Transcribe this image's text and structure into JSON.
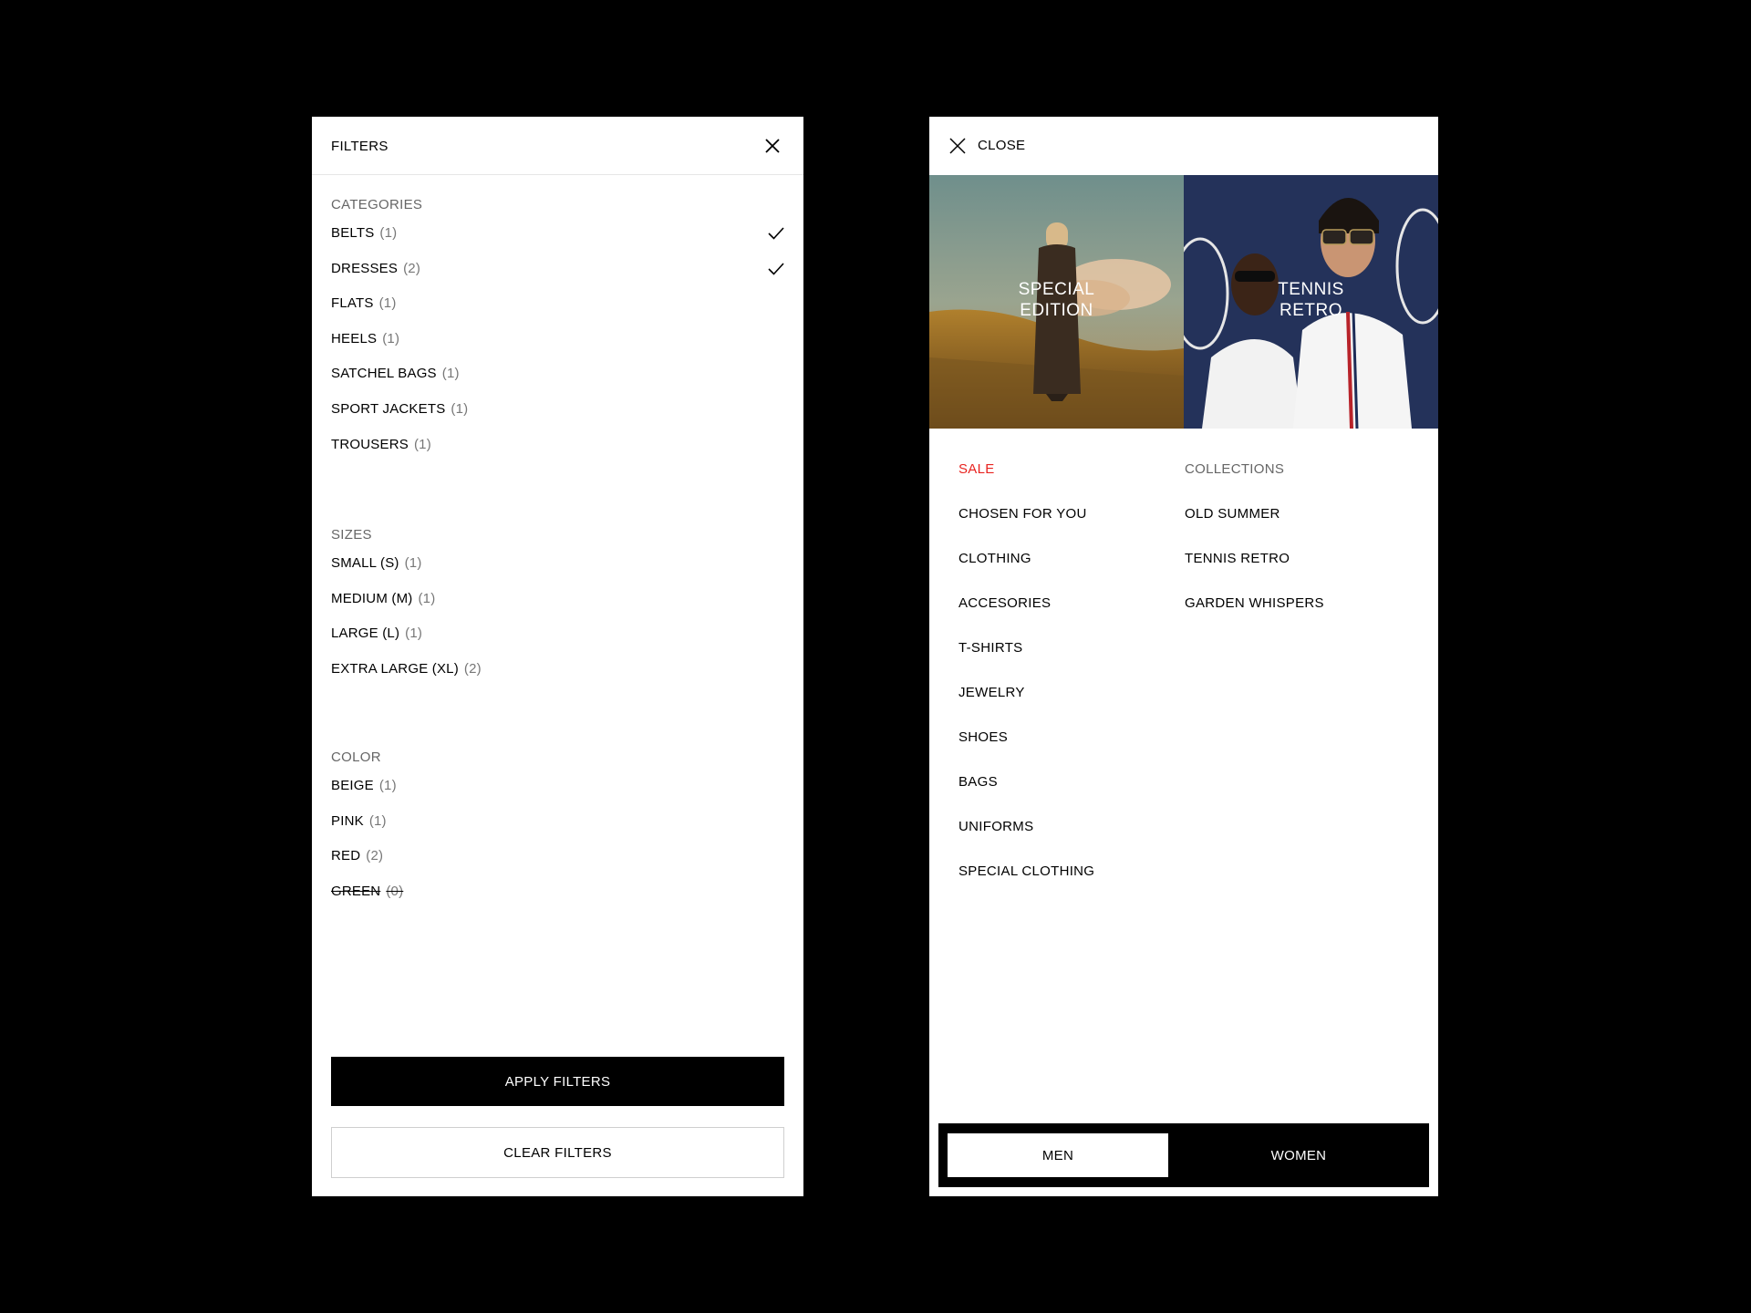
{
  "filters": {
    "title": "FILTERS",
    "sections": [
      {
        "title": "CATEGORIES",
        "options": [
          {
            "label": "BELTS",
            "count": "(1)",
            "checked": true
          },
          {
            "label": "DRESSES",
            "count": "(2)",
            "checked": true
          },
          {
            "label": "FLATS",
            "count": "(1)"
          },
          {
            "label": "HEELS",
            "count": "(1)"
          },
          {
            "label": "SATCHEL BAGS",
            "count": "(1)"
          },
          {
            "label": "SPORT JACKETS",
            "count": "(1)"
          },
          {
            "label": "TROUSERS",
            "count": "(1)"
          }
        ]
      },
      {
        "title": "SIZES",
        "options": [
          {
            "label": "SMALL (S)",
            "count": "(1)"
          },
          {
            "label": "MEDIUM (M)",
            "count": "(1)"
          },
          {
            "label": "LARGE (L)",
            "count": "(1)"
          },
          {
            "label": "EXTRA LARGE (XL)",
            "count": "(2)"
          }
        ]
      },
      {
        "title": "COLOR",
        "options": [
          {
            "label": "BEIGE",
            "count": "(1)"
          },
          {
            "label": "PINK",
            "count": "(1)"
          },
          {
            "label": "RED",
            "count": "(2)"
          },
          {
            "label": "GREEN",
            "count": "(0)",
            "disabled": true
          }
        ]
      }
    ],
    "apply_label": "APPLY FILTERS",
    "clear_label": "CLEAR FILTERS"
  },
  "menu": {
    "close_label": "CLOSE",
    "heroes": [
      {
        "label": "SPECIAL\nEDITION"
      },
      {
        "label": "TENNIS\nRETRO"
      }
    ],
    "left_items": [
      {
        "label": "SALE",
        "highlight": true
      },
      {
        "label": "CHOSEN FOR YOU"
      },
      {
        "label": "CLOTHING"
      },
      {
        "label": "ACCESORIES"
      },
      {
        "label": "T-SHIRTS"
      },
      {
        "label": "JEWELRY"
      },
      {
        "label": "SHOES"
      },
      {
        "label": "BAGS"
      },
      {
        "label": "UNIFORMS"
      },
      {
        "label": "SPECIAL CLOTHING"
      }
    ],
    "right_heading": "COLLECTIONS",
    "right_items": [
      {
        "label": "OLD SUMMER"
      },
      {
        "label": "TENNIS RETRO"
      },
      {
        "label": "GARDEN WHISPERS"
      }
    ],
    "gender": {
      "men": "MEN",
      "women": "WOMEN",
      "selected": "MEN"
    }
  },
  "colors": {
    "sale": "#e8231f",
    "background": "#000000",
    "panel": "#ffffff"
  },
  "icons": {
    "close": "close-icon",
    "check": "checkmark-icon"
  }
}
